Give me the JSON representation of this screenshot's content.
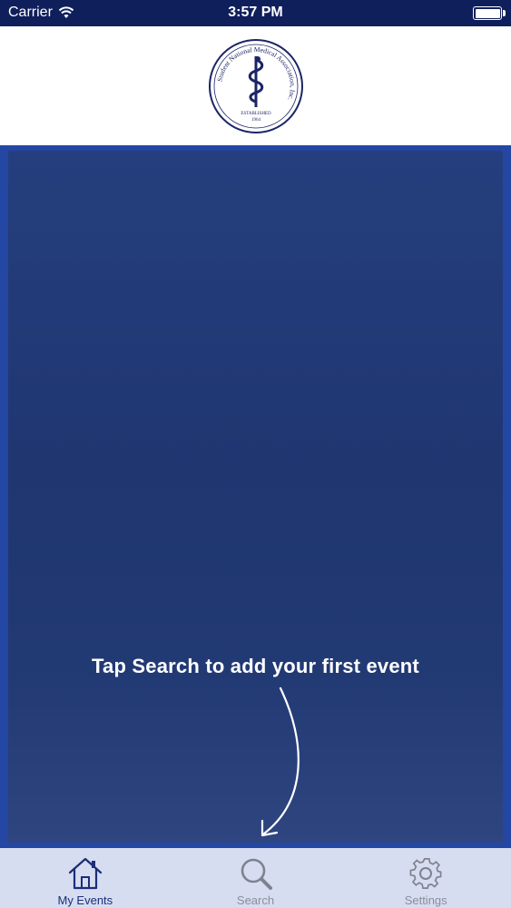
{
  "status_bar": {
    "carrier": "Carrier",
    "time": "3:57 PM",
    "battery_level": 1.0
  },
  "header": {
    "logo": {
      "icon": "organization-seal-logo",
      "text": "Student National Medical Association, Inc.",
      "established_label": "ESTABLISHED",
      "year": "1964"
    }
  },
  "main": {
    "hint_text": "Tap Search to add your first event"
  },
  "tab_bar": {
    "tabs": [
      {
        "label": "My Events",
        "icon": "home-icon",
        "active": true
      },
      {
        "label": "Search",
        "icon": "search-icon",
        "active": false
      },
      {
        "label": "Settings",
        "icon": "gear-icon",
        "active": false
      }
    ]
  },
  "colors": {
    "status_bar": "#0f1f5c",
    "accent": "#1b2e7a",
    "panel": "#223a74",
    "tab_bar": "#d6ddf0"
  }
}
